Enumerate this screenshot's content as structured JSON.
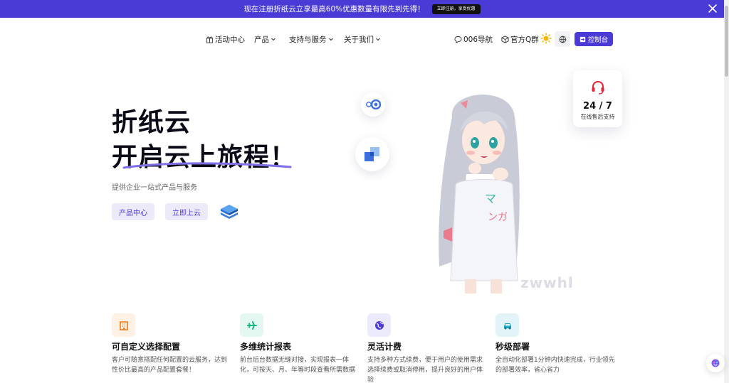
{
  "promo": {
    "text": "现在注册折纸云立享最高60%优惠数量有限先到先得！",
    "button": "立即注册，享受优惠"
  },
  "nav": {
    "items": [
      {
        "label": "活动中心"
      },
      {
        "label": "产品"
      },
      {
        "label": "支持与服务"
      },
      {
        "label": "关于我们"
      }
    ],
    "right": {
      "nav006": "006导航",
      "qq_group": "官方Q群",
      "console": "控制台"
    }
  },
  "hero": {
    "title_line1": "折纸云",
    "title_line2": "开启云上旅程！",
    "subtitle": "提供企业一站式产品与服务",
    "buttons": [
      "产品中心",
      "立即上云"
    ]
  },
  "support": {
    "number": "24 / 7",
    "label": "在线售后支持"
  },
  "watermark": "zwwhl",
  "features": [
    {
      "title": "可自定义选择配置",
      "desc": "客户可随意搭配任何配置的云服务，达到性价比最高的产品配置套餐！",
      "icon": "building-icon",
      "color": "#f07a1a",
      "bg": "#fff1e4"
    },
    {
      "title": "多维统计报表",
      "desc": "前台后台数据无缝对接，实现报表一体化，可按天、月、年等时段查看所需数据",
      "icon": "plane-icon",
      "color": "#12b886",
      "bg": "#e3f8f0"
    },
    {
      "title": "灵活计费",
      "desc": "支持多种方式续费，便于用户的使用需求选择续费或取消停用，提升良好的用户体验",
      "icon": "globe-icon",
      "color": "#4b3bd6",
      "bg": "#ecebfb"
    },
    {
      "title": "秒级部署",
      "desc": "全自动化部署1分钟内快速完成，行业领先的部署效率，省心省力",
      "icon": "car-icon",
      "color": "#1aa7c2",
      "bg": "#e3f4f8"
    }
  ],
  "colors": {
    "brand": "#4b3bd6",
    "banner": "#4b3bd6"
  }
}
